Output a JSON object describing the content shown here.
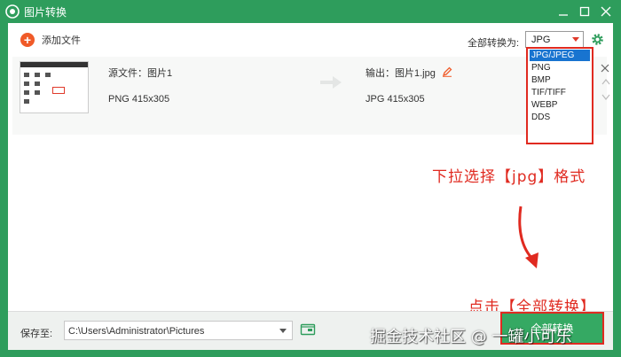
{
  "window": {
    "title": "图片转换",
    "icons": {
      "logo": "camera-eye-icon",
      "minimize": "minimize-icon",
      "maximize": "maximize-icon",
      "close": "close-icon"
    }
  },
  "toolbar": {
    "add_file_label": "添加文件",
    "convert_all_label": "全部转换为:",
    "selected_format": "JPG"
  },
  "format_dropdown": {
    "options": [
      "JPG/JPEG",
      "PNG",
      "BMP",
      "TIF/TIFF",
      "WEBP",
      "DDS"
    ],
    "selected_index": 0
  },
  "file_row": {
    "source_name": "源文件：图片1",
    "source_info": "PNG   415x305",
    "output_name": "输出：图片1.jpg",
    "output_info": "JPG   415x305"
  },
  "annotations": {
    "dropdown_hint": "下拉选择【jpg】格式",
    "convert_hint": "点击【全部转换】"
  },
  "bottom": {
    "save_label": "保存至:",
    "save_path": "C:\\Users\\Administrator\\Pictures",
    "convert_button": "全部转换",
    "watermark": "掘金技术社区 @ 一罐小可乐"
  },
  "colors": {
    "brand_green": "#2e9d5c",
    "accent_orange": "#f05a28",
    "annotation_red": "#e02a20",
    "selection_blue": "#1874d0"
  }
}
